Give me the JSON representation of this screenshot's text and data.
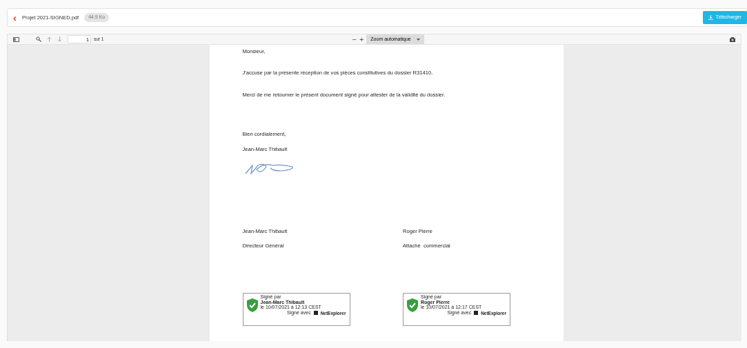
{
  "header": {
    "back": "‹",
    "file_name": "Projet 2021-SIGNED.pdf",
    "file_size": "44.9 Ko",
    "download_label": "Télécharger"
  },
  "toolbar": {
    "page_value": "1",
    "page_total": "sur 1",
    "zoom_out": "−",
    "zoom_in": "+",
    "zoom_select": "Zoom automatique"
  },
  "letter": {
    "salutation": "Monsieur,",
    "paragraphs": [
      "J'accuse par la présente réception de vos pièces constitutives du dossier R31410.",
      "Merci de me retourner le présent document signé pour attester de la validité du dossier."
    ],
    "closing": "Bien cordialement,",
    "author": "Jean-Marc Thibault",
    "signatories": [
      {
        "name": "Jean-Marc Thibault",
        "role": "Directeur Général"
      },
      {
        "name": "Roger Pierre",
        "role": "Attaché  commercial"
      }
    ],
    "stamps": [
      {
        "label": "Signé par",
        "name": "Jean-Marc Thibault",
        "date": "le 10/07/2021 à 12:13 CEST",
        "via": "Signé avec",
        "brand": "NetExplorer"
      },
      {
        "label": "Signé par",
        "name": "Roger Pierre",
        "date": "le 10/07/2021 à 12:17 CEST",
        "via": "Signé avec",
        "brand": "NetExplorer"
      }
    ]
  }
}
